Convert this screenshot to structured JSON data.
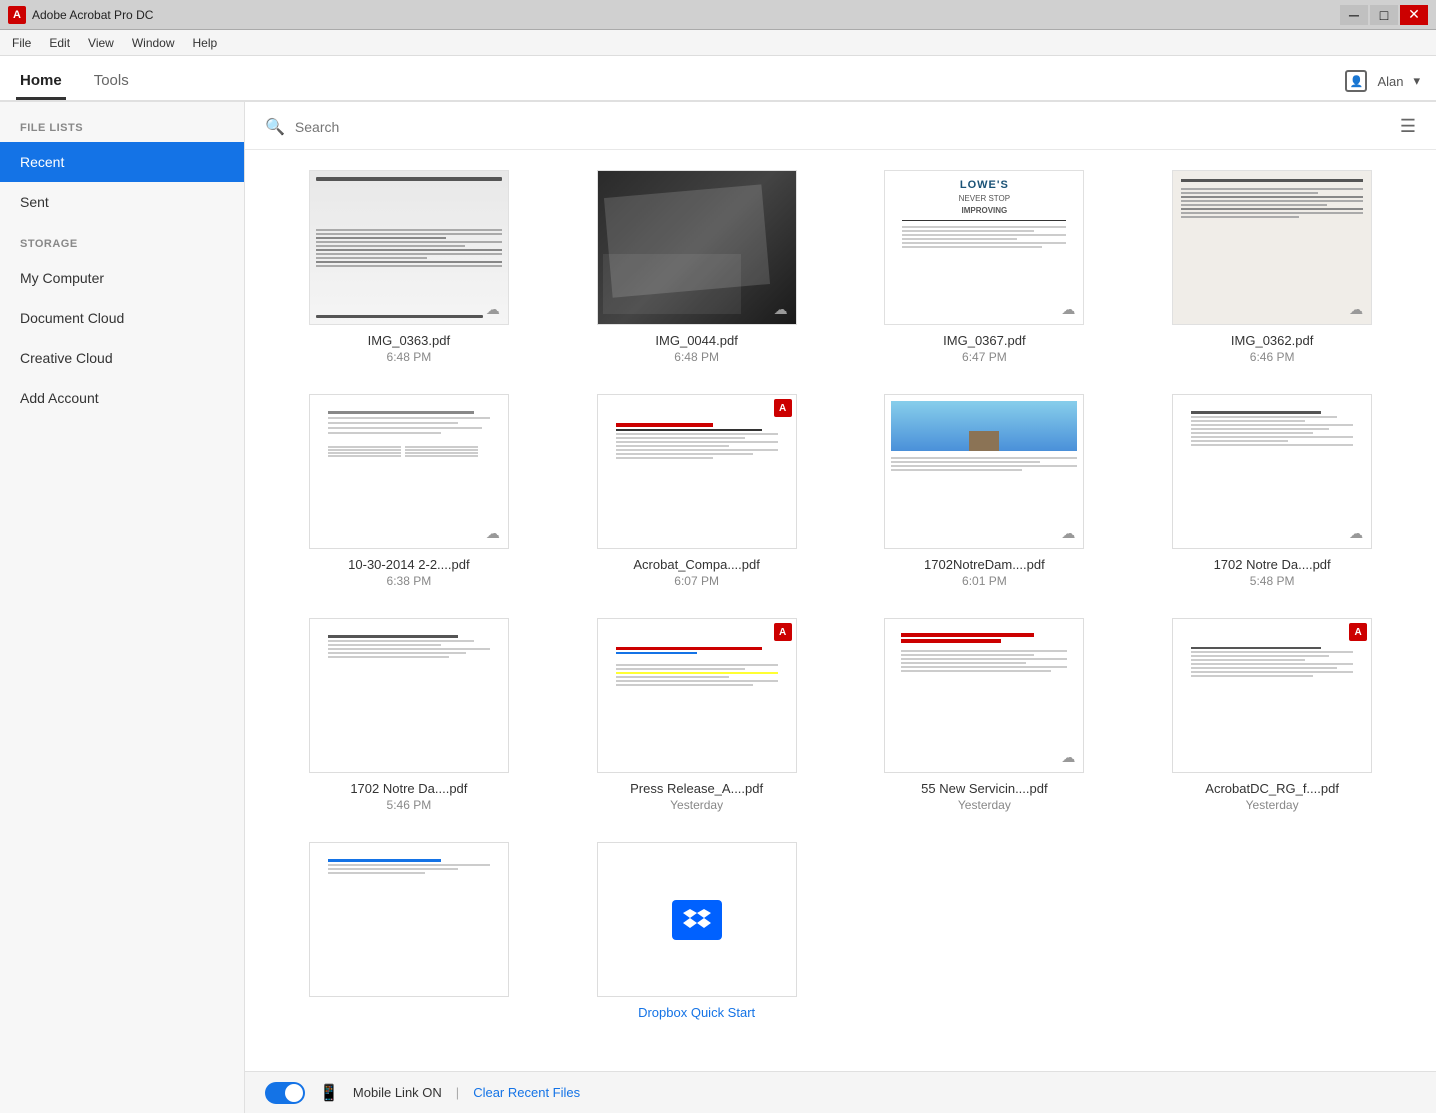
{
  "titleBar": {
    "icon": "A",
    "title": "Adobe Acrobat Pro DC",
    "minimizeLabel": "─",
    "restoreLabel": "□",
    "closeLabel": "✕"
  },
  "menuBar": {
    "items": [
      "File",
      "Edit",
      "View",
      "Window",
      "Help"
    ]
  },
  "tabs": {
    "items": [
      "Home",
      "Tools"
    ],
    "activeIndex": 0,
    "userLabel": "Alan"
  },
  "sidebar": {
    "fileLists": {
      "label": "FILE LISTS",
      "items": [
        {
          "id": "recent",
          "label": "Recent",
          "active": true
        },
        {
          "id": "sent",
          "label": "Sent",
          "active": false
        }
      ]
    },
    "storage": {
      "label": "STORAGE",
      "items": [
        {
          "id": "my-computer",
          "label": "My Computer"
        },
        {
          "id": "document-cloud",
          "label": "Document Cloud"
        },
        {
          "id": "creative-cloud",
          "label": "Creative Cloud"
        },
        {
          "id": "add-account",
          "label": "Add Account"
        }
      ]
    }
  },
  "search": {
    "placeholder": "Search"
  },
  "files": [
    {
      "id": 1,
      "name": "IMG_0363.pdf",
      "time": "6:48 PM",
      "cloud": true,
      "adobe": false,
      "thumbType": "receipt"
    },
    {
      "id": 2,
      "name": "IMG_0044.pdf",
      "time": "6:48 PM",
      "cloud": true,
      "adobe": false,
      "thumbType": "photo"
    },
    {
      "id": 3,
      "name": "IMG_0367.pdf",
      "time": "6:47 PM",
      "cloud": true,
      "adobe": false,
      "thumbType": "lowes"
    },
    {
      "id": 4,
      "name": "IMG_0362.pdf",
      "time": "6:46 PM",
      "cloud": true,
      "adobe": false,
      "thumbType": "receipt2"
    },
    {
      "id": 5,
      "name": "10-30-2014 2-2....pdf",
      "time": "6:38 PM",
      "cloud": true,
      "adobe": false,
      "thumbType": "doc"
    },
    {
      "id": 6,
      "name": "Acrobat_Compa....pdf",
      "time": "6:07 PM",
      "cloud": false,
      "adobe": true,
      "thumbType": "acrobat-doc"
    },
    {
      "id": 7,
      "name": "1702NotreDam....pdf",
      "time": "6:01 PM",
      "cloud": true,
      "adobe": false,
      "thumbType": "notre-dame1"
    },
    {
      "id": 8,
      "name": "1702 Notre Da....pdf",
      "time": "5:48 PM",
      "cloud": true,
      "adobe": false,
      "thumbType": "notre-dame2"
    },
    {
      "id": 9,
      "name": "1702 Notre Da....pdf",
      "time": "5:46 PM",
      "cloud": false,
      "adobe": false,
      "thumbType": "notre-dame3"
    },
    {
      "id": 10,
      "name": "Press Release_A....pdf",
      "time": "Yesterday",
      "cloud": false,
      "adobe": true,
      "thumbType": "press-release"
    },
    {
      "id": 11,
      "name": "55 New Servicin....pdf",
      "time": "Yesterday",
      "cloud": true,
      "adobe": false,
      "thumbType": "servicing"
    },
    {
      "id": 12,
      "name": "AcrobatDC_RG_f....pdf",
      "time": "Yesterday",
      "cloud": false,
      "adobe": true,
      "thumbType": "acrobat-rg"
    },
    {
      "id": 13,
      "name": "",
      "time": "",
      "cloud": false,
      "adobe": false,
      "thumbType": "blank"
    },
    {
      "id": 14,
      "name": "Dropbox Quick Start",
      "time": "",
      "cloud": false,
      "adobe": false,
      "thumbType": "dropbox"
    }
  ],
  "footer": {
    "mobileLink": "Mobile Link ON",
    "divider": "|",
    "clearLabel": "Clear Recent Files"
  }
}
